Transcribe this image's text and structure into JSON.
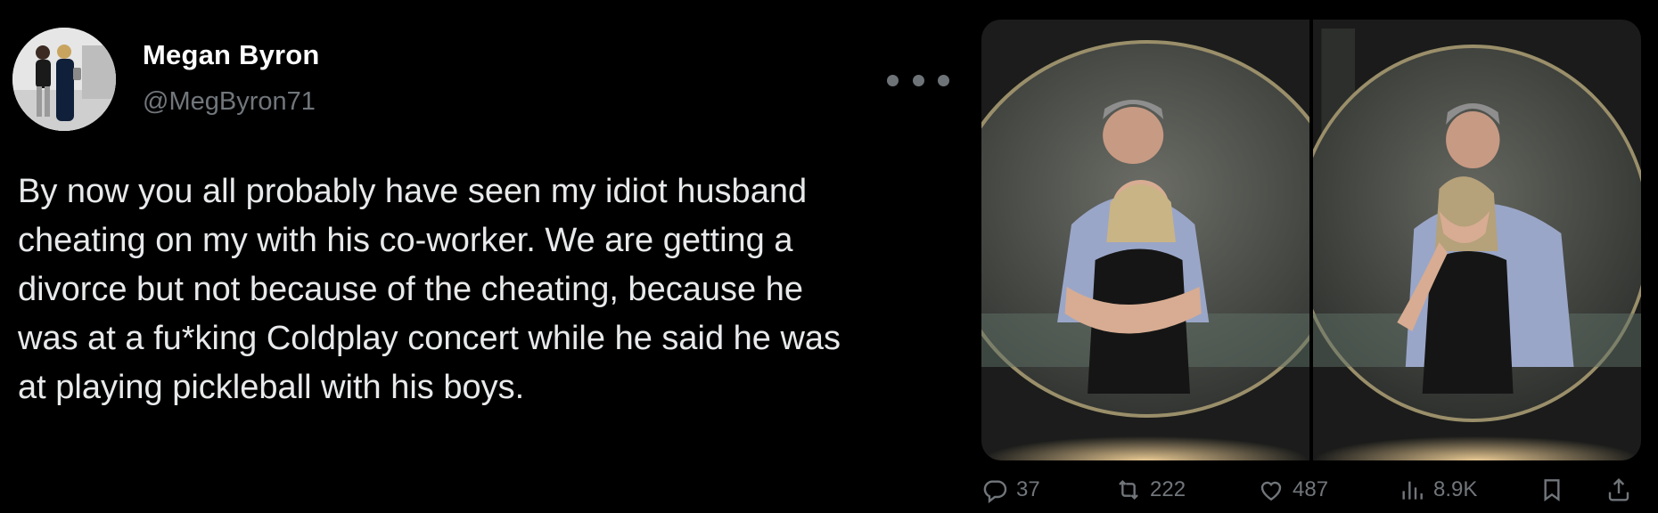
{
  "author": {
    "display_name": "Megan Byron",
    "handle": "@MegByron71",
    "avatar_icon": "profile-photo-couple-walking"
  },
  "tweet": {
    "text": "By now you all probably have seen my idiot husband\ncheating on my with his co-worker. We are getting a\ndivorce but not because of the cheating, because he\nwas at a fu*king Coldplay concert while he said he was\nat playing pickleball with his boys."
  },
  "media": {
    "photos": [
      {
        "icon": "concert-jumbotron-couple-embracing"
      },
      {
        "icon": "concert-jumbotron-couple-hiding-faces"
      }
    ]
  },
  "actions": {
    "reply": {
      "icon": "reply-icon",
      "count": "37"
    },
    "retweet": {
      "icon": "retweet-icon",
      "count": "222"
    },
    "like": {
      "icon": "heart-icon",
      "count": "487"
    },
    "views": {
      "icon": "views-chart-icon",
      "count": "8.9K"
    },
    "bookmark": {
      "icon": "bookmark-icon"
    },
    "share": {
      "icon": "share-icon"
    }
  },
  "colors": {
    "background": "#000000",
    "text_primary": "#e7e9ea",
    "text_secondary": "#71767b"
  }
}
